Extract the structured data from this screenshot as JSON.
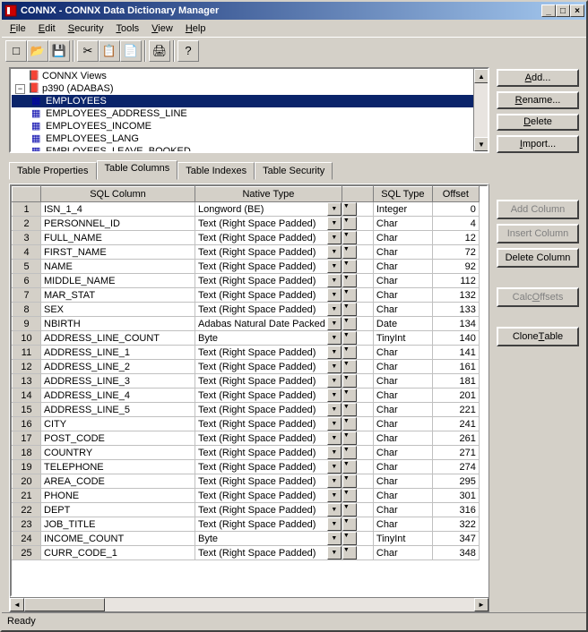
{
  "title": "CONNX - CONNX Data Dictionary Manager",
  "menu": [
    "File",
    "Edit",
    "Security",
    "Tools",
    "View",
    "Help"
  ],
  "menu_underline": [
    "F",
    "E",
    "T",
    "H"
  ],
  "toolbar_icons": [
    {
      "name": "new-icon",
      "glyph": "□"
    },
    {
      "name": "open-icon",
      "glyph": "📂"
    },
    {
      "name": "save-icon",
      "glyph": "💾"
    },
    {
      "name": "sep"
    },
    {
      "name": "cut-icon",
      "glyph": "✂"
    },
    {
      "name": "copy-icon",
      "glyph": "📋"
    },
    {
      "name": "paste-icon",
      "glyph": "📄"
    },
    {
      "name": "sep"
    },
    {
      "name": "print-icon",
      "glyph": "🖨"
    },
    {
      "name": "sep"
    },
    {
      "name": "help-icon",
      "glyph": "?"
    }
  ],
  "tree": [
    {
      "indent": 1,
      "icon": "📕",
      "label": "CONNX Views",
      "cls": "node-red"
    },
    {
      "indent": 1,
      "icon": "📕",
      "label": "p390 (ADABAS)",
      "cls": "node-red",
      "expander": "-"
    },
    {
      "indent": 2,
      "icon": "▦",
      "label": "EMPLOYEES",
      "cls": "node-blue",
      "sel": true
    },
    {
      "indent": 2,
      "icon": "▦",
      "label": "EMPLOYEES_ADDRESS_LINE",
      "cls": "node-blue"
    },
    {
      "indent": 2,
      "icon": "▦",
      "label": "EMPLOYEES_INCOME",
      "cls": "node-blue"
    },
    {
      "indent": 2,
      "icon": "▦",
      "label": "EMPLOYEES_LANG",
      "cls": "node-blue"
    },
    {
      "indent": 2,
      "icon": "▦",
      "label": "EMPLOYEES_LEAVE_BOOKED",
      "cls": "node-blue"
    }
  ],
  "side_buttons": [
    {
      "label": "Add...",
      "u": "A"
    },
    {
      "label": "Rename...",
      "u": "R"
    },
    {
      "label": "Delete",
      "u": "D"
    },
    {
      "label": "Import...",
      "u": "I"
    }
  ],
  "tabs": [
    "Table Properties",
    "Table Columns",
    "Table Indexes",
    "Table Security"
  ],
  "active_tab": 1,
  "grid_headers": [
    "",
    "SQL Column",
    "Native Type",
    "",
    "SQL Type",
    "Offset"
  ],
  "grid_rows": [
    [
      "1",
      "ISN_1_4",
      "Longword (BE)",
      "",
      "Integer",
      "0"
    ],
    [
      "2",
      "PERSONNEL_ID",
      "Text (Right Space Padded)",
      "",
      "Char",
      "4"
    ],
    [
      "3",
      "FULL_NAME",
      "Text (Right Space Padded)",
      "",
      "Char",
      "12"
    ],
    [
      "4",
      "FIRST_NAME",
      "Text (Right Space Padded)",
      "",
      "Char",
      "72"
    ],
    [
      "5",
      "NAME",
      "Text (Right Space Padded)",
      "",
      "Char",
      "92"
    ],
    [
      "6",
      "MIDDLE_NAME",
      "Text (Right Space Padded)",
      "",
      "Char",
      "112"
    ],
    [
      "7",
      "MAR_STAT",
      "Text (Right Space Padded)",
      "",
      "Char",
      "132"
    ],
    [
      "8",
      "SEX",
      "Text (Right Space Padded)",
      "",
      "Char",
      "133"
    ],
    [
      "9",
      "NBIRTH",
      "Adabas Natural Date Packed",
      "",
      "Date",
      "134"
    ],
    [
      "10",
      "ADDRESS_LINE_COUNT",
      "Byte",
      "",
      "TinyInt",
      "140"
    ],
    [
      "11",
      "ADDRESS_LINE_1",
      "Text (Right Space Padded)",
      "",
      "Char",
      "141"
    ],
    [
      "12",
      "ADDRESS_LINE_2",
      "Text (Right Space Padded)",
      "",
      "Char",
      "161"
    ],
    [
      "13",
      "ADDRESS_LINE_3",
      "Text (Right Space Padded)",
      "",
      "Char",
      "181"
    ],
    [
      "14",
      "ADDRESS_LINE_4",
      "Text (Right Space Padded)",
      "",
      "Char",
      "201"
    ],
    [
      "15",
      "ADDRESS_LINE_5",
      "Text (Right Space Padded)",
      "",
      "Char",
      "221"
    ],
    [
      "16",
      "CITY",
      "Text (Right Space Padded)",
      "",
      "Char",
      "241"
    ],
    [
      "17",
      "POST_CODE",
      "Text (Right Space Padded)",
      "",
      "Char",
      "261"
    ],
    [
      "18",
      "COUNTRY",
      "Text (Right Space Padded)",
      "",
      "Char",
      "271"
    ],
    [
      "19",
      "TELEPHONE",
      "Text (Right Space Padded)",
      "",
      "Char",
      "274"
    ],
    [
      "20",
      "AREA_CODE",
      "Text (Right Space Padded)",
      "",
      "Char",
      "295"
    ],
    [
      "21",
      "PHONE",
      "Text (Right Space Padded)",
      "",
      "Char",
      "301"
    ],
    [
      "22",
      "DEPT",
      "Text (Right Space Padded)",
      "",
      "Char",
      "316"
    ],
    [
      "23",
      "JOB_TITLE",
      "Text (Right Space Padded)",
      "",
      "Char",
      "322"
    ],
    [
      "24",
      "INCOME_COUNT",
      "Byte",
      "",
      "TinyInt",
      "347"
    ],
    [
      "25",
      "CURR_CODE_1",
      "Text (Right Space Padded)",
      "",
      "Char",
      "348"
    ]
  ],
  "right_buttons": [
    {
      "label": "Add Column",
      "disabled": true,
      "u": ""
    },
    {
      "label": "Insert Column",
      "disabled": true,
      "u": ""
    },
    {
      "label": "Delete Column",
      "disabled": false,
      "u": ""
    },
    {
      "gap": true
    },
    {
      "label": "Calc Offsets",
      "disabled": true,
      "u": "O"
    },
    {
      "gap": true
    },
    {
      "label": "Clone Table",
      "disabled": false,
      "u": "T"
    }
  ],
  "status": "Ready"
}
